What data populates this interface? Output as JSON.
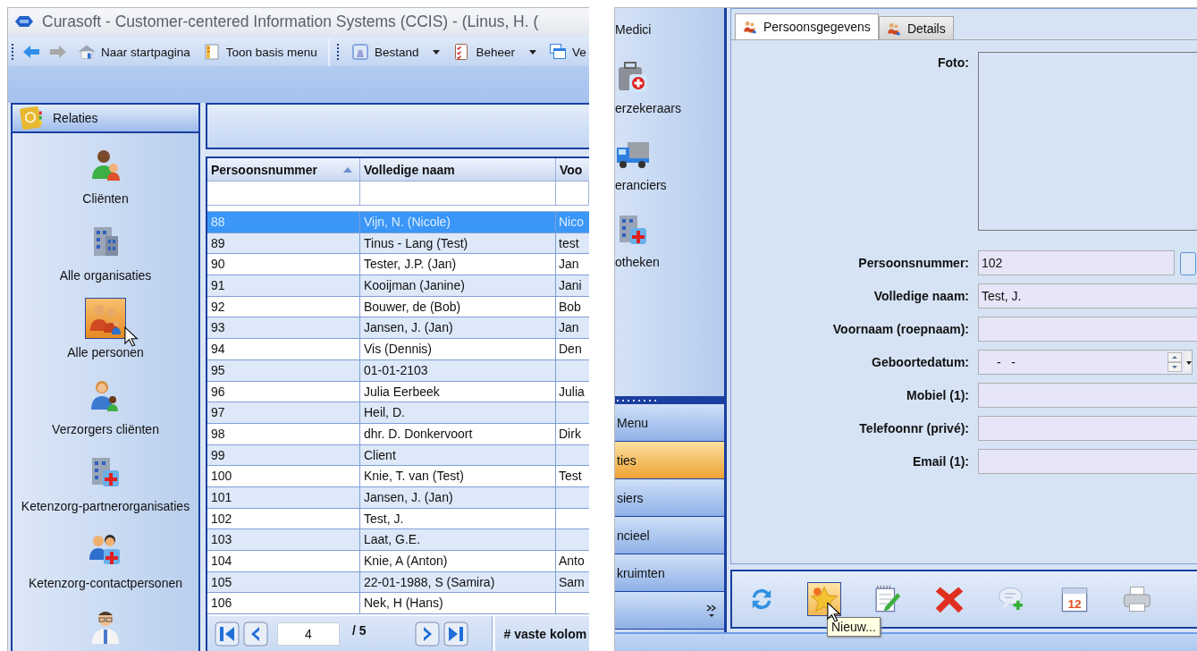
{
  "left_window": {
    "title": "Curasoft - Customer-centered Information Systems (CCIS) - (Linus, H. (",
    "toolbar": [
      {
        "kind": "back",
        "disabled": false
      },
      {
        "kind": "forward",
        "disabled": true
      },
      {
        "kind": "button",
        "label": "Naar startpagina"
      },
      {
        "kind": "button",
        "label": "Toon basis menu"
      },
      {
        "kind": "separator"
      },
      {
        "kind": "dropdown",
        "label": "Bestand"
      },
      {
        "kind": "dropdown",
        "label": "Beheer"
      },
      {
        "kind": "button",
        "label": "Ve"
      }
    ],
    "sidebar": {
      "title": "Relaties",
      "items": [
        {
          "label": "Cliënten",
          "selected": false
        },
        {
          "label": "Alle organisaties",
          "selected": false
        },
        {
          "label": "Alle personen",
          "selected": true
        },
        {
          "label": "Verzorgers cliënten",
          "selected": false
        },
        {
          "label": "Ketenzorg-partnerorganisaties",
          "selected": false
        },
        {
          "label": "Ketenzorg-contactpersonen",
          "selected": false
        }
      ]
    },
    "grid": {
      "columns": [
        {
          "label": "Persoonsnummer",
          "sorted": true
        },
        {
          "label": "Volledige naam",
          "sorted": false
        },
        {
          "label": "Voo",
          "sorted": false
        }
      ],
      "rows": [
        {
          "number": "88",
          "name": "Vijn, N. (Nicole)",
          "column_3": "Nico",
          "selected": true
        },
        {
          "number": "89",
          "name": "Tinus - Lang (Test)",
          "column_3": "test",
          "selected": false
        },
        {
          "number": "90",
          "name": "Tester, J.P. (Jan)",
          "column_3": "Jan",
          "selected": false
        },
        {
          "number": "91",
          "name": "Kooijman (Janine)",
          "column_3": "Jani",
          "selected": false
        },
        {
          "number": "92",
          "name": "Bouwer, de (Bob)",
          "column_3": "Bob",
          "selected": false
        },
        {
          "number": "93",
          "name": "Jansen, J. (Jan)",
          "column_3": "Jan",
          "selected": false
        },
        {
          "number": "94",
          "name": "Vis (Dennis)",
          "column_3": "Den",
          "selected": false
        },
        {
          "number": "95",
          "name": "01-01-2103",
          "selected": false
        },
        {
          "number": "96",
          "name": "Julia Eerbeek",
          "column_3": "Julia",
          "selected": false
        },
        {
          "number": "97",
          "name": "Heil, D.",
          "selected": false
        },
        {
          "number": "98",
          "name": "dhr. D. Donkervoort",
          "column_3": "Dirk",
          "selected": false
        },
        {
          "number": "99",
          "name": "Client",
          "selected": false
        },
        {
          "number": "100",
          "name": "Knie, T. van (Test)",
          "column_3": "Test",
          "selected": false
        },
        {
          "number": "101",
          "name": "Jansen, J. (Jan)",
          "selected": false
        },
        {
          "number": "102",
          "name": "Test, J.",
          "selected": false
        },
        {
          "number": "103",
          "name": "Laat, G.E.",
          "selected": false
        },
        {
          "number": "104",
          "name": "Knie, A (Anton)",
          "column_3": "Anto",
          "selected": false
        },
        {
          "number": "105",
          "name": "22-01-1988, S (Samira)",
          "column_3": "Sam",
          "selected": false
        },
        {
          "number": "106",
          "name": "Nek, H (Hans)",
          "selected": false
        }
      ]
    },
    "pager": {
      "page": "4",
      "total": "/ 5"
    },
    "fixed_columns_label": "# vaste kolom"
  },
  "right_window": {
    "nav_items": [
      {
        "label": "Medici"
      },
      {
        "label": "erzekeraars"
      },
      {
        "label": "eranciers"
      },
      {
        "label": "otheken"
      }
    ],
    "nav_buttons": [
      {
        "label": "Menu",
        "selected": false
      },
      {
        "label": "ties",
        "selected": true
      },
      {
        "label": "siers",
        "selected": false
      },
      {
        "label": "ncieel",
        "selected": false
      },
      {
        "label": "kruimten",
        "selected": false
      }
    ],
    "tabs": [
      {
        "label": "Persoonsgegevens",
        "selected": true
      },
      {
        "label": "Details",
        "selected": false
      }
    ],
    "photo_label": "Foto:",
    "fields": [
      {
        "label": "Persoonsnummer:",
        "value": "102",
        "kind": "lookup"
      },
      {
        "label": "Volledige naam:",
        "value": "Test, J.",
        "kind": "text"
      },
      {
        "label": "Voornaam (roepnaam):",
        "kind": "text"
      },
      {
        "label": "Geboortedatum:",
        "value": "-   -",
        "kind": "date"
      },
      {
        "label": "Mobiel (1):",
        "kind": "text"
      },
      {
        "label": "Telefoonnr (privé):",
        "kind": "text"
      },
      {
        "label": "Email (1):",
        "kind": "text"
      }
    ],
    "actions": [
      {
        "kind": "refresh",
        "hovered": false
      },
      {
        "kind": "new",
        "hovered": true
      },
      {
        "kind": "edit",
        "hovered": false
      },
      {
        "kind": "delete",
        "hovered": false
      },
      {
        "kind": "comment",
        "hovered": false
      },
      {
        "kind": "calendar",
        "day": "12",
        "hovered": false
      },
      {
        "kind": "print",
        "hovered": false
      }
    ],
    "tooltip": "Nieuw..."
  }
}
